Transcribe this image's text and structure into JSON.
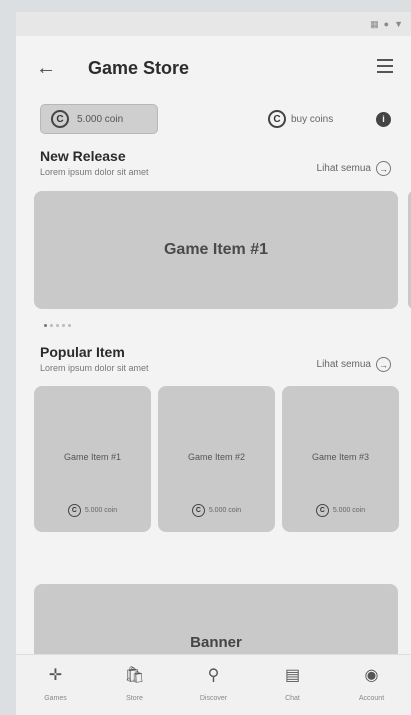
{
  "header": {
    "title": "Game Store",
    "back_icon": "arrow-left-icon",
    "menu_icon": "hamburger-menu-icon"
  },
  "status_icons": [
    "signal-icon",
    "wifi-icon",
    "battery-icon"
  ],
  "coins": {
    "balance": "5.000 coin",
    "buy_label": "buy coins",
    "coin_icon": "coin-icon",
    "info_icon": "info-icon"
  },
  "new_release": {
    "title": "New Release",
    "subtitle": "Lorem ipsum dolor sit amet",
    "see_all": "Lihat semua",
    "hero_item": "Game Item #1",
    "page_dots": 5,
    "active_dot": 0
  },
  "popular": {
    "title": "Popular Item",
    "subtitle": "Lorem ipsum dolor sit amet",
    "see_all": "Lihat semua",
    "items": [
      {
        "name": "Game Item #1",
        "price": "5.000 coin"
      },
      {
        "name": "Game Item #2",
        "price": "5.000 coin"
      },
      {
        "name": "Game Item #3",
        "price": "5.000 coin"
      }
    ]
  },
  "banner": {
    "label": "Banner"
  },
  "bottom_nav": [
    {
      "label": "Games",
      "icon": "gamepad-icon"
    },
    {
      "label": "Store",
      "icon": "store-bag-icon"
    },
    {
      "label": "Discover",
      "icon": "search-icon"
    },
    {
      "label": "Chat",
      "icon": "chat-icon"
    },
    {
      "label": "Account",
      "icon": "account-icon"
    }
  ],
  "colors": {
    "background": "#f3f3f3",
    "placeholder": "#c9c9c9",
    "text": "#2b2b2b"
  }
}
